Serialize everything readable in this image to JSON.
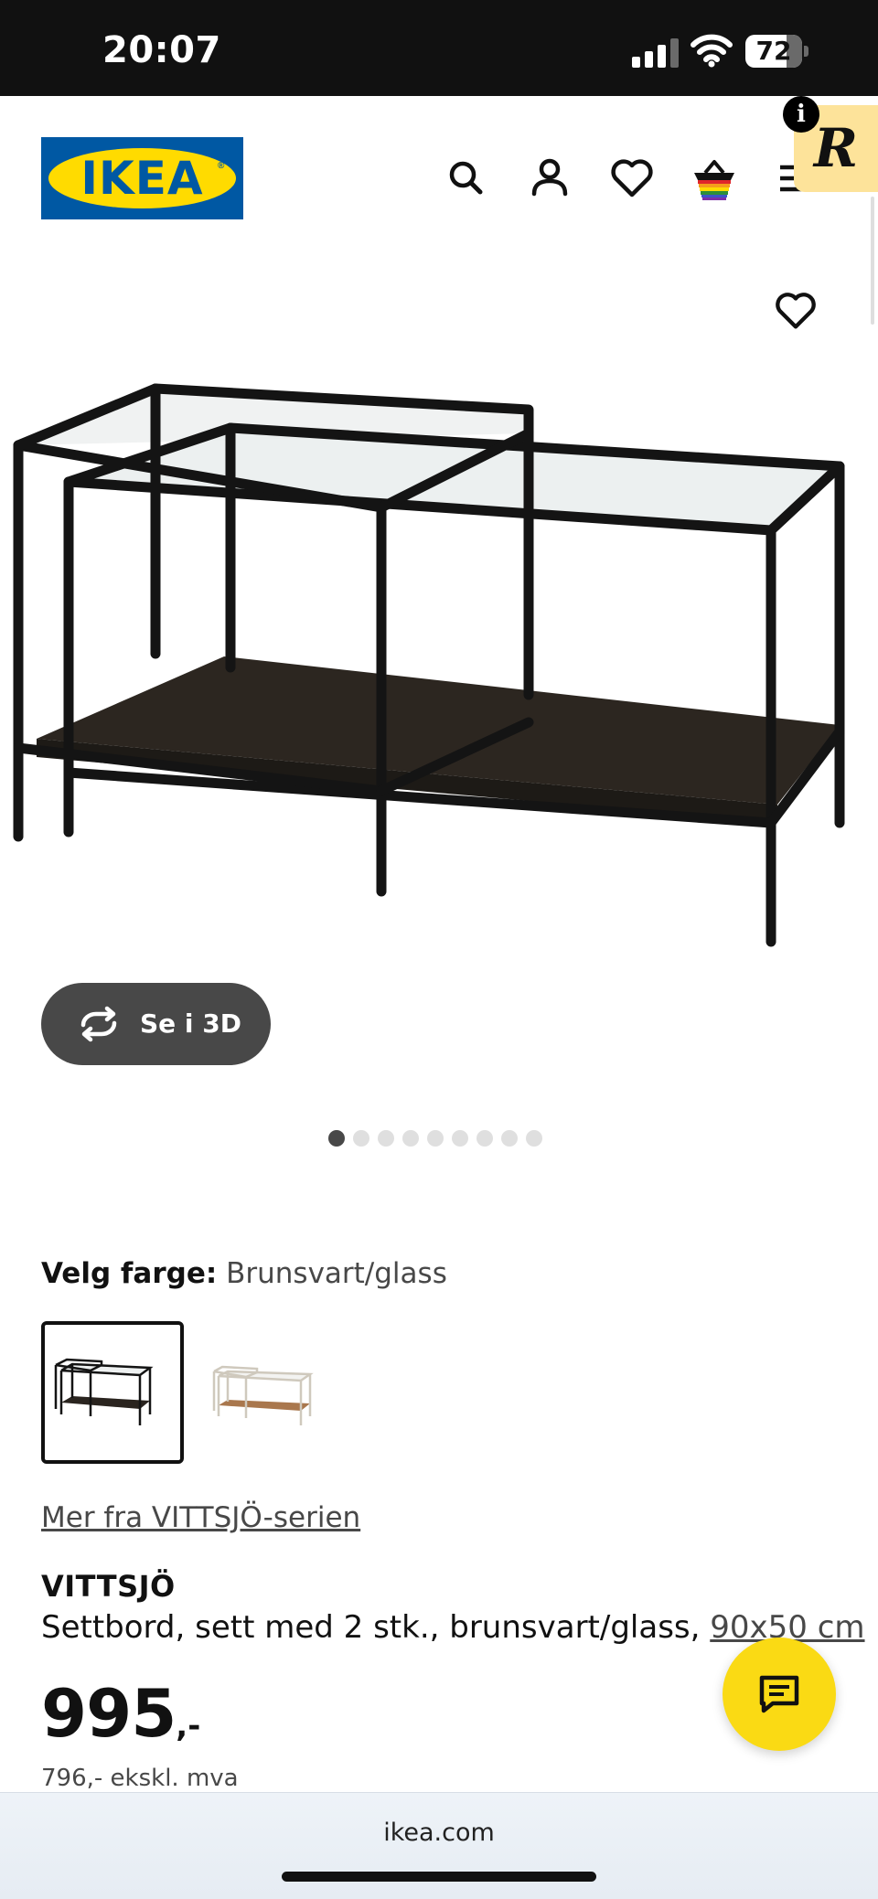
{
  "status_bar": {
    "time": "20:07",
    "battery": "72"
  },
  "header": {
    "logo_text": "IKEA",
    "icons": [
      "search-icon",
      "account-icon",
      "favourites-icon",
      "cart-icon",
      "menu-icon"
    ]
  },
  "extension_badge": {
    "letter": "R",
    "info": "i"
  },
  "gallery": {
    "view_3d_label": "Se i 3D",
    "image_count": 9,
    "active_index": 0
  },
  "color": {
    "label": "Velg farge:",
    "value": "Brunsvart/glass",
    "options": [
      "brunsvart-glass",
      "hvit-glass"
    ]
  },
  "series_link": "Mer fra VITTSJÖ-serien",
  "product": {
    "name": "VITTSJÖ",
    "description": "Settbord, sett med 2 stk., brunsvart/glass, ",
    "dimensions": "90x50 cm",
    "price": "995",
    "price_suffix": ",-",
    "price_ex_vat": "796,- ekskl. mva"
  },
  "browser": {
    "url": "ikea.com"
  },
  "colors": {
    "ikea_blue": "#0058a3",
    "ikea_yellow": "#ffdb00",
    "chat_yellow": "#fada14"
  }
}
